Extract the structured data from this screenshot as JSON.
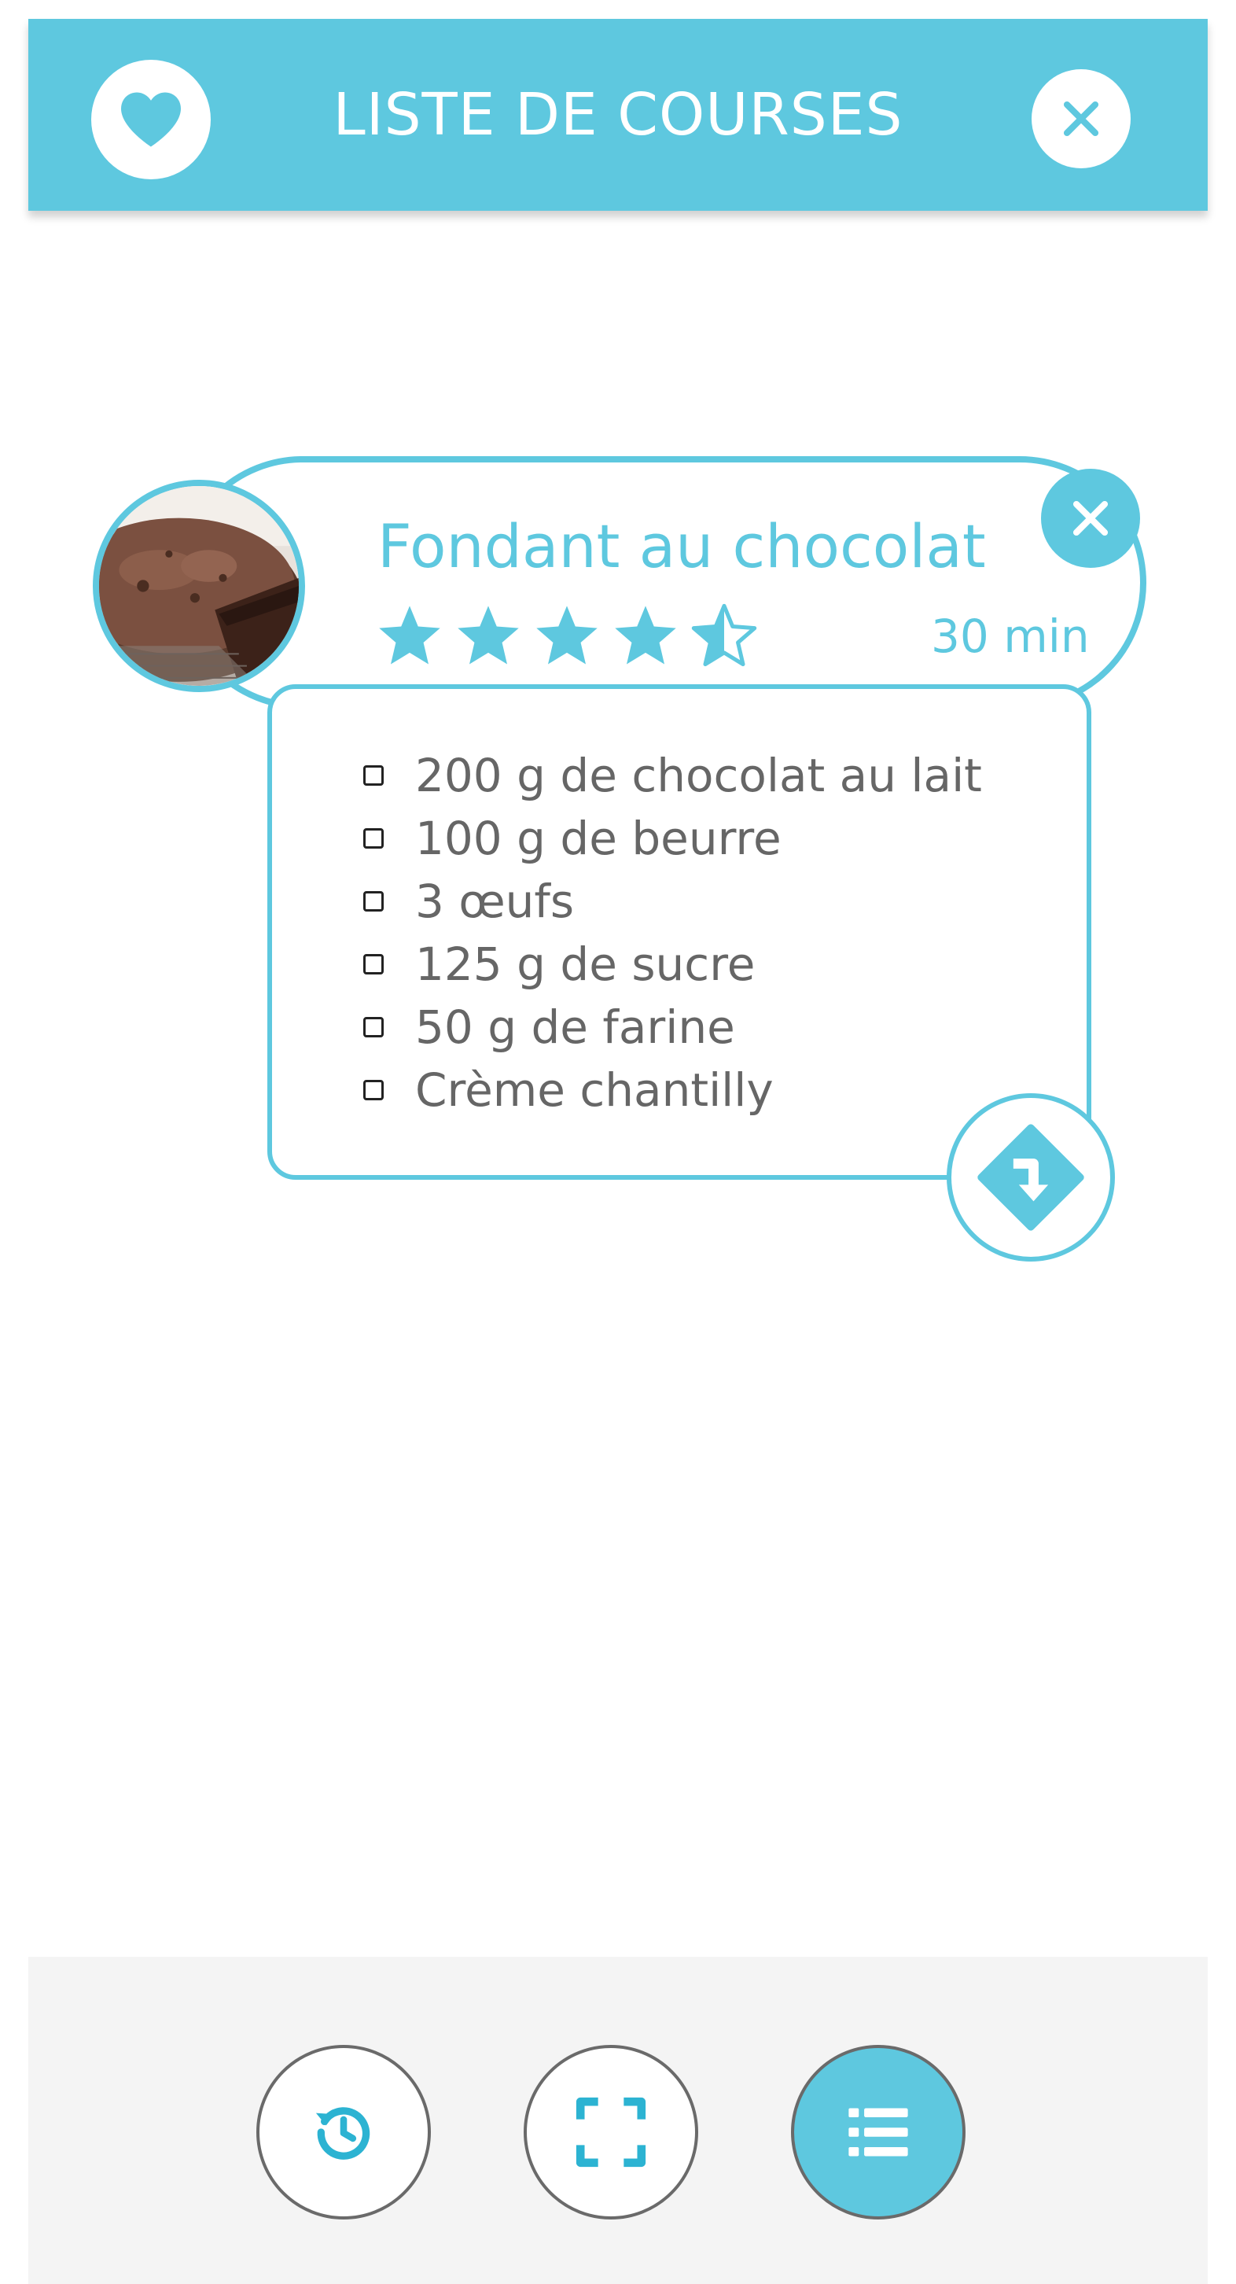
{
  "colors": {
    "accent": "#5ec8df",
    "text_muted": "#666666",
    "bottom_bar": "#f4f4f4",
    "icon_dark": "#2cb3d2"
  },
  "header": {
    "title": "LISTE DE COURSES",
    "left_icon": "heart-icon",
    "right_icon": "close-icon"
  },
  "recipe": {
    "title": "Fondant au chocolat",
    "rating": 4.5,
    "rating_max": 5,
    "time": "30 min",
    "photo_icon": "chocolate-cake-photo",
    "close_icon": "close-icon",
    "ingredients": [
      "200 g de chocolat au lait",
      "100 g de beurre",
      "3 œufs",
      "125 g de sucre",
      "50 g de farine",
      "Crème chantilly"
    ],
    "direction_icon": "turn-right-diamond-icon"
  },
  "bottom_nav": [
    {
      "icon": "history-icon",
      "active": false
    },
    {
      "icon": "scan-icon",
      "active": false
    },
    {
      "icon": "list-icon",
      "active": true
    }
  ]
}
